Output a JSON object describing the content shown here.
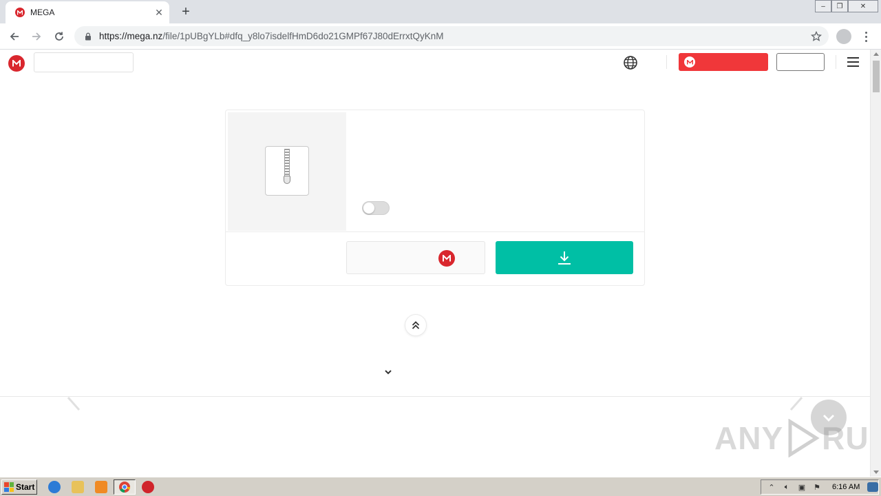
{
  "browser": {
    "tab_title": "MEGA",
    "tab_close": "✕",
    "new_tab": "+",
    "url_host": "https://mega.nz",
    "url_path": "/file/1pUBgYLb#dfq_y8lo7isdelfHmD6do21GMPf67J80dErrxtQyKnM",
    "window_controls": {
      "minimize": "–",
      "restore": "❐",
      "close": "✕"
    }
  },
  "page": {
    "brand_color": "#d9272e",
    "download_color": "#00bfa5",
    "create_button_color": "#f0373a",
    "logo_letter": "M"
  },
  "taskbar": {
    "start_label": "Start",
    "clock": "6:16 AM"
  },
  "watermark": {
    "left": "ANY",
    "right": "RUN"
  }
}
